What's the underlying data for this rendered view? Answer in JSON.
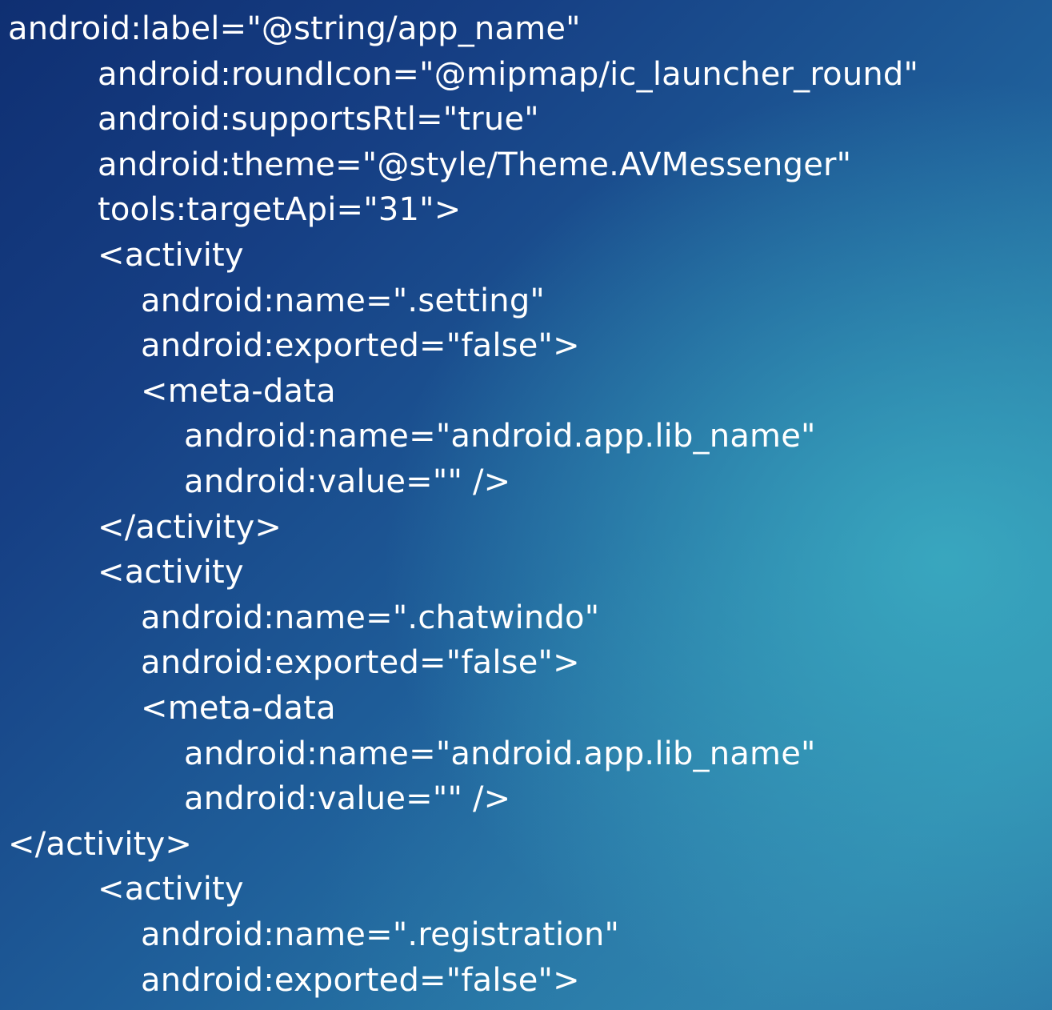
{
  "code_lines": [
    {
      "text": "android:label=\"@string/app_name\"",
      "indent": 0
    },
    {
      "text": "android:roundIcon=\"@mipmap/ic_launcher_round\"",
      "indent": 1
    },
    {
      "text": "android:supportsRtl=\"true\"",
      "indent": 1
    },
    {
      "text": "android:theme=\"@style/Theme.AVMessenger\"",
      "indent": 1
    },
    {
      "text": "tools:targetApi=\"31\">",
      "indent": 1
    },
    {
      "text": "<activity",
      "indent": 1
    },
    {
      "text": "android:name=\".setting\"",
      "indent": 2
    },
    {
      "text": "android:exported=\"false\">",
      "indent": 2
    },
    {
      "text": "<meta-data",
      "indent": 2
    },
    {
      "text": "android:name=\"android.app.lib_name\"",
      "indent": 3
    },
    {
      "text": "android:value=\"\" />",
      "indent": 3
    },
    {
      "text": "</activity>",
      "indent": 1
    },
    {
      "text": "<activity",
      "indent": 1
    },
    {
      "text": "android:name=\".chatwindo\"",
      "indent": 2
    },
    {
      "text": "android:exported=\"false\">",
      "indent": 2
    },
    {
      "text": "<meta-data",
      "indent": 2
    },
    {
      "text": "android:name=\"android.app.lib_name\"",
      "indent": 3
    },
    {
      "text": "android:value=\"\" />",
      "indent": 3
    },
    {
      "text": "</activity>",
      "indent": 0
    },
    {
      "text": "<activity",
      "indent": 1
    },
    {
      "text": "android:name=\".registration\"",
      "indent": 2
    },
    {
      "text": "android:exported=\"false\">",
      "indent": 2
    }
  ]
}
